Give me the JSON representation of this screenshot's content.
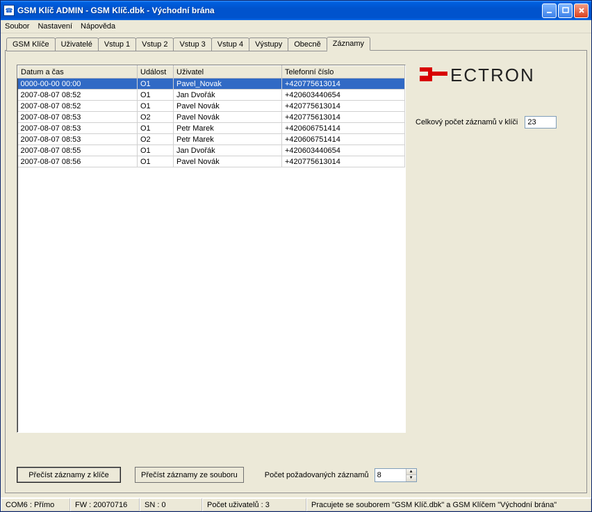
{
  "window": {
    "title": "GSM Klíč ADMIN - GSM Klíč.dbk - Východní brána"
  },
  "menu": {
    "file": "Soubor",
    "settings": "Nastavení",
    "help": "Nápověda"
  },
  "tabs": [
    "GSM Klíče",
    "Uživatelé",
    "Vstup 1",
    "Vstup 2",
    "Vstup 3",
    "Vstup 4",
    "Výstupy",
    "Obecně",
    "Záznamy"
  ],
  "active_tab_index": 8,
  "table": {
    "columns": {
      "datetime": "Datum a čas",
      "event": "Událost",
      "user": "Uživatel",
      "phone": "Telefonní číslo"
    },
    "rows": [
      {
        "datetime": "0000-00-00 00:00",
        "event": "O1",
        "user": "Pavel_Novak",
        "phone": "+420775613014"
      },
      {
        "datetime": "2007-08-07 08:52",
        "event": "O1",
        "user": "Jan Dvořák",
        "phone": "+420603440654"
      },
      {
        "datetime": "2007-08-07 08:52",
        "event": "O1",
        "user": "Pavel Novák",
        "phone": "+420775613014"
      },
      {
        "datetime": "2007-08-07 08:53",
        "event": "O2",
        "user": "Pavel Novák",
        "phone": "+420775613014"
      },
      {
        "datetime": "2007-08-07 08:53",
        "event": "O1",
        "user": "Petr Marek",
        "phone": "+420606751414"
      },
      {
        "datetime": "2007-08-07 08:53",
        "event": "O2",
        "user": "Petr Marek",
        "phone": "+420606751414"
      },
      {
        "datetime": "2007-08-07 08:55",
        "event": "O1",
        "user": "Jan Dvořák",
        "phone": "+420603440654"
      },
      {
        "datetime": "2007-08-07 08:56",
        "event": "O1",
        "user": "Pavel Novák",
        "phone": "+420775613014"
      }
    ],
    "selected_index": 0
  },
  "right": {
    "total_label": "Celkový počet záznamů v klíči",
    "total_value": "23",
    "logo_text": "ECTRON"
  },
  "buttons": {
    "read_from_key": "Přečíst záznamy z klíče",
    "read_from_file": "Přečíst záznamy ze souboru",
    "requested_label": "Počet požadovaných záznamů",
    "requested_value": "8"
  },
  "status": {
    "port": "COM6 : Přímo",
    "fw": "FW : 20070716",
    "sn": "SN : 0",
    "users": "Počet uživatelů : 3",
    "msg": "Pracujete se souborem \"GSM Klíč.dbk\" a GSM Klíčem \"Východní brána\""
  }
}
